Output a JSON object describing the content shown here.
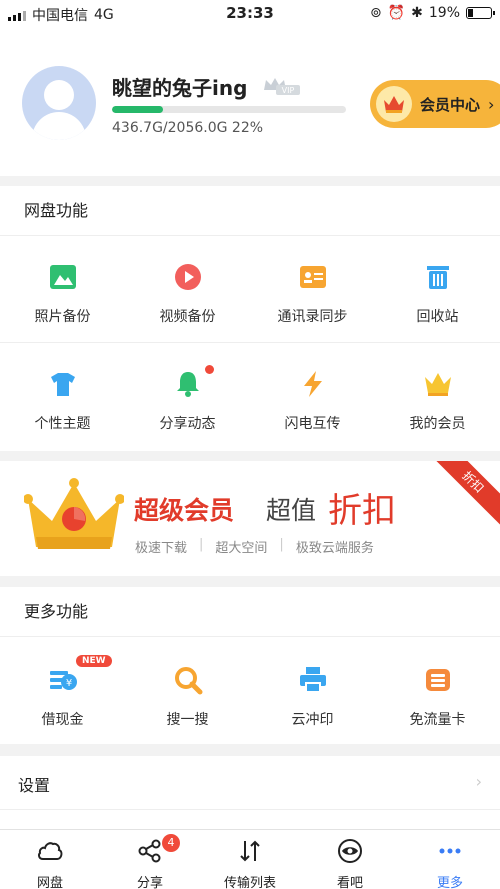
{
  "status_bar": {
    "carrier": "中国电信",
    "network": "4G",
    "time": "23:33",
    "battery": "19%"
  },
  "profile": {
    "username": "眺望的兔子ing",
    "vip_label": "VIP",
    "storage_text": "436.7G/2056.0G 22%",
    "storage_fraction": 0.22,
    "member_center_label": "会员中心"
  },
  "disk_features": {
    "title": "网盘功能",
    "items": [
      {
        "label": "照片备份",
        "icon": "photo-icon"
      },
      {
        "label": "视频备份",
        "icon": "video-icon"
      },
      {
        "label": "通讯录同步",
        "icon": "contacts-icon"
      },
      {
        "label": "回收站",
        "icon": "trash-icon"
      },
      {
        "label": "个性主题",
        "icon": "shirt-icon"
      },
      {
        "label": "分享动态",
        "icon": "bell-icon"
      },
      {
        "label": "闪电互传",
        "icon": "lightning-icon"
      },
      {
        "label": "我的会员",
        "icon": "crown-icon"
      }
    ]
  },
  "banner": {
    "title_red": "超级会员",
    "title_gray": "超值",
    "title_big": "折扣",
    "features": [
      "极速下载",
      "超大空间",
      "极致云端服务"
    ],
    "ribbon": "折扣"
  },
  "more_features": {
    "title": "更多功能",
    "new_badge": "NEW",
    "items": [
      {
        "label": "借现金",
        "icon": "cash-icon"
      },
      {
        "label": "搜一搜",
        "icon": "search-icon"
      },
      {
        "label": "云冲印",
        "icon": "printer-icon"
      },
      {
        "label": "免流量卡",
        "icon": "sim-card-icon"
      }
    ]
  },
  "settings": {
    "label": "设置"
  },
  "tabbar": {
    "share_badge": "4",
    "items": [
      {
        "label": "网盘",
        "icon": "cloud-icon"
      },
      {
        "label": "分享",
        "icon": "share-icon"
      },
      {
        "label": "传输列表",
        "icon": "transfer-icon"
      },
      {
        "label": "看吧",
        "icon": "eye-icon"
      },
      {
        "label": "更多",
        "icon": "more-icon"
      }
    ]
  },
  "colors": {
    "accent_blue": "#3a7cf5",
    "brand_red": "#e13b2a",
    "storage_green": "#26b86a",
    "member_gold": "#f6b43b"
  }
}
